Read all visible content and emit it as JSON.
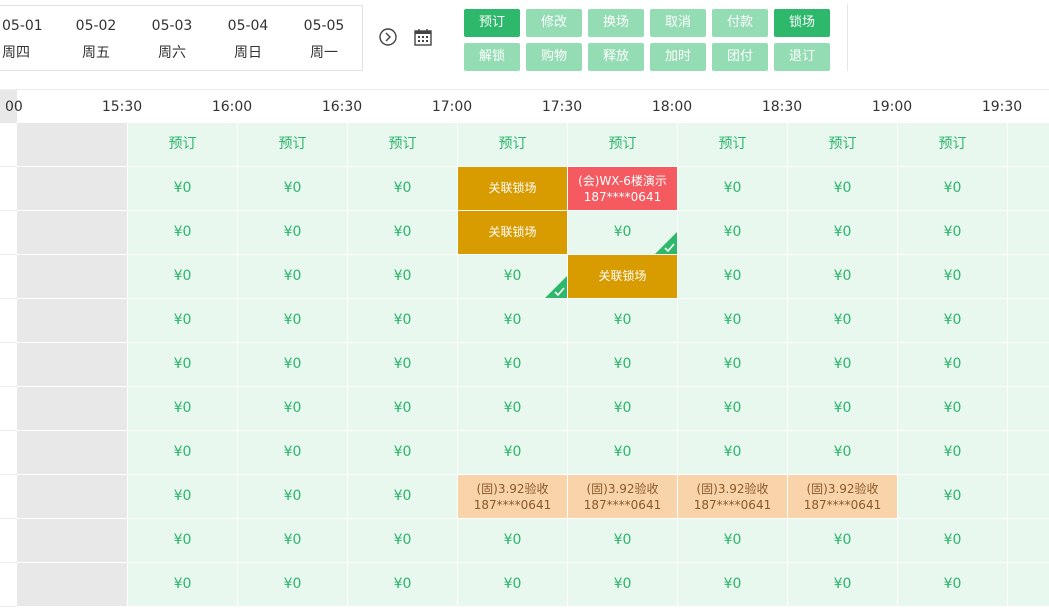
{
  "dates": [
    {
      "date": "05-01",
      "weekday": "周四"
    },
    {
      "date": "05-02",
      "weekday": "周五"
    },
    {
      "date": "05-03",
      "weekday": "周六"
    },
    {
      "date": "05-04",
      "weekday": "周日"
    },
    {
      "date": "05-05",
      "weekday": "周一"
    }
  ],
  "icons": {
    "next": "circle-chevron-right-icon",
    "calendar": "calendar-icon"
  },
  "actions": [
    {
      "label": "预订",
      "state": "active"
    },
    {
      "label": "修改",
      "state": "disabled"
    },
    {
      "label": "换场",
      "state": "disabled"
    },
    {
      "label": "取消",
      "state": "disabled"
    },
    {
      "label": "付款",
      "state": "disabled"
    },
    {
      "label": "锁场",
      "state": "active"
    },
    {
      "label": "解锁",
      "state": "disabled"
    },
    {
      "label": "购物",
      "state": "disabled"
    },
    {
      "label": "释放",
      "state": "disabled"
    },
    {
      "label": "加时",
      "state": "disabled"
    },
    {
      "label": "团付",
      "state": "disabled"
    },
    {
      "label": "退订",
      "state": "disabled"
    }
  ],
  "times": [
    "00",
    "15:30",
    "16:00",
    "16:30",
    "17:00",
    "17:30",
    "18:00",
    "18:30",
    "19:00",
    "19:30"
  ],
  "colors": {
    "green": "#2db86b",
    "lightgreen": "#94dcb4",
    "cell": "#e9f8ef",
    "orange": "#d89b00",
    "red": "#f45a5f",
    "peach": "#f9d4aa"
  },
  "grid": [
    [
      "预订",
      "预订",
      "预订",
      "预订",
      "预订",
      "预订",
      "预订",
      "预订"
    ],
    [
      "¥0",
      "¥0",
      "¥0",
      "关联锁场",
      "(会)WX-6楼演示|187****0641",
      "¥0",
      "¥0",
      "¥0"
    ],
    [
      "¥0",
      "¥0",
      "¥0",
      "关联锁场",
      "¥0",
      "¥0",
      "¥0",
      "¥0"
    ],
    [
      "¥0",
      "¥0",
      "¥0",
      "¥0",
      "关联锁场",
      "¥0",
      "¥0",
      "¥0"
    ],
    [
      "¥0",
      "¥0",
      "¥0",
      "¥0",
      "¥0",
      "¥0",
      "¥0",
      "¥0"
    ],
    [
      "¥0",
      "¥0",
      "¥0",
      "¥0",
      "¥0",
      "¥0",
      "¥0",
      "¥0"
    ],
    [
      "¥0",
      "¥0",
      "¥0",
      "¥0",
      "¥0",
      "¥0",
      "¥0",
      "¥0"
    ],
    [
      "¥0",
      "¥0",
      "¥0",
      "¥0",
      "¥0",
      "¥0",
      "¥0",
      "¥0"
    ],
    [
      "¥0",
      "¥0",
      "¥0",
      "(固)3.92验收|187****0641",
      "(固)3.92验收|187****0641",
      "(固)3.92验收|187****0641",
      "(固)3.92验收|187****0641",
      "¥0"
    ],
    [
      "¥0",
      "¥0",
      "¥0",
      "¥0",
      "¥0",
      "¥0",
      "¥0",
      "¥0"
    ],
    [
      "¥0",
      "¥0",
      "¥0",
      "¥0",
      "¥0",
      "¥0",
      "¥0",
      "¥0"
    ]
  ],
  "cell_status": [
    [
      "",
      "",
      "",
      "",
      "",
      "",
      "",
      ""
    ],
    [
      "",
      "",
      "",
      "orange",
      "red",
      "",
      "",
      ""
    ],
    [
      "",
      "",
      "",
      "orange",
      "checked",
      "",
      "",
      ""
    ],
    [
      "",
      "",
      "",
      "checked",
      "orange",
      "",
      "",
      ""
    ],
    [
      "",
      "",
      "",
      "",
      "",
      "",
      "",
      ""
    ],
    [
      "",
      "",
      "",
      "",
      "",
      "",
      "",
      ""
    ],
    [
      "",
      "",
      "",
      "",
      "",
      "",
      "",
      ""
    ],
    [
      "",
      "",
      "",
      "",
      "",
      "",
      "",
      ""
    ],
    [
      "",
      "",
      "",
      "peach",
      "peach",
      "peach",
      "peach",
      ""
    ],
    [
      "",
      "",
      "",
      "",
      "",
      "",
      "",
      ""
    ],
    [
      "",
      "",
      "",
      "",
      "",
      "",
      "",
      ""
    ]
  ]
}
